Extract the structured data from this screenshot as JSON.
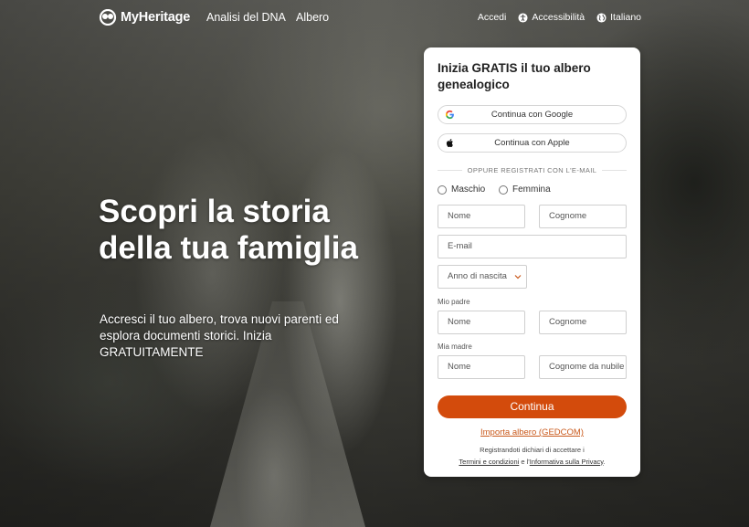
{
  "header": {
    "logo_text": "MyHeritage",
    "nav": {
      "dna": "Analisi del DNA",
      "tree": "Albero"
    },
    "right": {
      "login": "Accedi",
      "accessibility": "Accessibilità",
      "language": "Italiano"
    }
  },
  "hero": {
    "title": "Scopri la storia della tua famiglia",
    "subtitle": "Accresci il tuo albero, trova nuovi parenti ed esplora documenti storici. Inizia GRATUITAMENTE"
  },
  "signup": {
    "title": "Inizia GRATIS il tuo albero genealogico",
    "google_label": "Continua con Google",
    "apple_label": "Continua con Apple",
    "divider": "OPPURE REGISTRATI CON L'E-MAIL",
    "gender": {
      "male": "Maschio",
      "female": "Femmina"
    },
    "placeholders": {
      "first_name": "Nome",
      "last_name": "Cognome",
      "email": "E-mail",
      "birth_year": "Anno di nascita",
      "father_first": "Nome",
      "father_last": "Cognome",
      "mother_first": "Nome",
      "mother_last": "Cognome da nubile"
    },
    "father_label": "Mio padre",
    "mother_label": "Mia madre",
    "continue_label": "Continua",
    "import_label": "Importa albero (GEDCOM)",
    "terms_prefix": "Registrandoti dichiari di accettare i",
    "terms_link": "Termini e condizioni",
    "terms_and": "e l'",
    "privacy_link": "Informativa sulla Privacy",
    "terms_suffix": "."
  },
  "colors": {
    "accent": "#d34b0c",
    "link": "#c9581a"
  }
}
